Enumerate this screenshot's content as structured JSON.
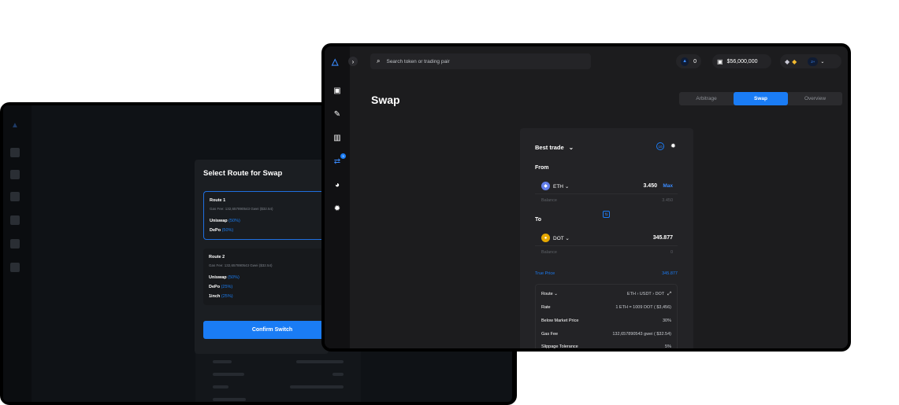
{
  "front": {
    "search_placeholder": "Search token or trading pair",
    "notifications_count": "0",
    "wallet_balance": "$56,000,000",
    "account_count": "2+",
    "page_title": "Swap",
    "tabs": [
      {
        "label": "Arbitrage",
        "active": false
      },
      {
        "label": "Swap",
        "active": true
      },
      {
        "label": "Overview",
        "active": false
      }
    ],
    "nav_badge": "3",
    "swap": {
      "best_trade_label": "Best trade",
      "slippage_badge": "10",
      "from_label": "From",
      "to_label": "To",
      "from_token": "ETH",
      "from_amount": "3.450",
      "max_label": "Max",
      "from_balance_label": "Balance",
      "from_balance": "3.450",
      "to_token": "DOT",
      "to_amount": "345.877",
      "to_balance_label": "Balance",
      "to_balance": "0",
      "true_price_label": "True Price",
      "true_price": "345.877",
      "details": [
        {
          "key": "Route",
          "value": "ETH  ›  USDT  ›  DOT"
        },
        {
          "key": "Rate",
          "value": "1 ETH = 1009 DOT ( $3,456)"
        },
        {
          "key": "Below Market Price",
          "value": "30%"
        },
        {
          "key": "Gas Fee",
          "value": "132,657890543 gwei ( $32.54)"
        },
        {
          "key": "Slippage Tolerance",
          "value": "5%"
        }
      ]
    }
  },
  "modal": {
    "title": "Select Route for Swap",
    "routes": [
      {
        "name": "Route 1",
        "gas": "Gas Fee: 132,657890543 Gwei ($32.54)",
        "lines": [
          {
            "dex": "Uniswap",
            "pct": "(50%)"
          },
          {
            "dex": "DePo",
            "pct": "(50%)"
          }
        ]
      },
      {
        "name": "Route 2",
        "gas": "Gas Fee: 132,657890543 Gwei ($32.54)",
        "lines": [
          {
            "dex": "Uniswap",
            "pct": "(50%)"
          },
          {
            "dex": "DePo",
            "pct": "(25%)"
          },
          {
            "dex": "1inch",
            "pct": "(25%)"
          }
        ]
      }
    ],
    "confirm_label": "Confirm Switch"
  },
  "colors": {
    "accent": "#1a7cf5",
    "background": "#1c1c1e",
    "card": "#232326"
  }
}
